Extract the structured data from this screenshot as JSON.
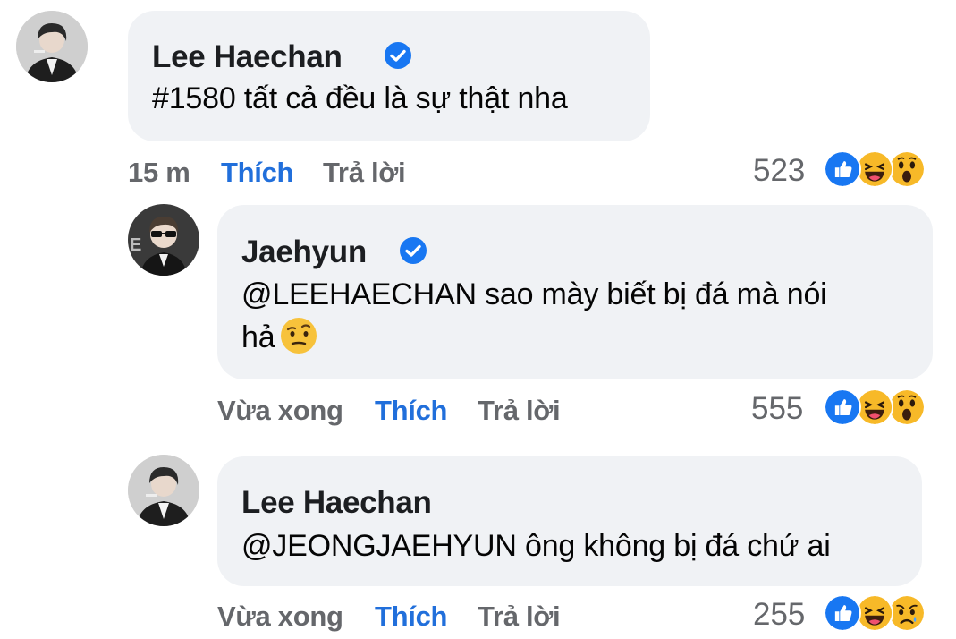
{
  "comments": [
    {
      "author": "Lee Haechan",
      "text": "#1580 tất cả đều là sự thật nha",
      "time": "15 m",
      "like_label": "Thích",
      "reply_label": "Trả lời",
      "reaction_count": "523",
      "verified": true,
      "reactions": [
        "like",
        "haha",
        "wow"
      ]
    },
    {
      "author": "Jaehyun",
      "text_line1": "@LEEHAECHAN sao mày biết bị đá mà nói",
      "text_line2": "hả",
      "time": "Vừa xong",
      "like_label": "Thích",
      "reply_label": "Trả lời",
      "reaction_count": "555",
      "verified": true,
      "reactions": [
        "like",
        "haha",
        "wow"
      ],
      "inline_emoji": "raised-eyebrow-emoji"
    },
    {
      "author": "Lee Haechan",
      "text": "@JEONGJAEHYUN ông không bị đá chứ ai",
      "time": "Vừa xong",
      "like_label": "Thích",
      "reply_label": "Trả lời",
      "reaction_count": "255",
      "verified": false,
      "reactions": [
        "like",
        "haha",
        "sad"
      ]
    }
  ],
  "colors": {
    "bubble": "#f0f2f5",
    "like_blue": "#216fdb",
    "meta_gray": "#65676b",
    "verified_blue": "#1877f2"
  }
}
